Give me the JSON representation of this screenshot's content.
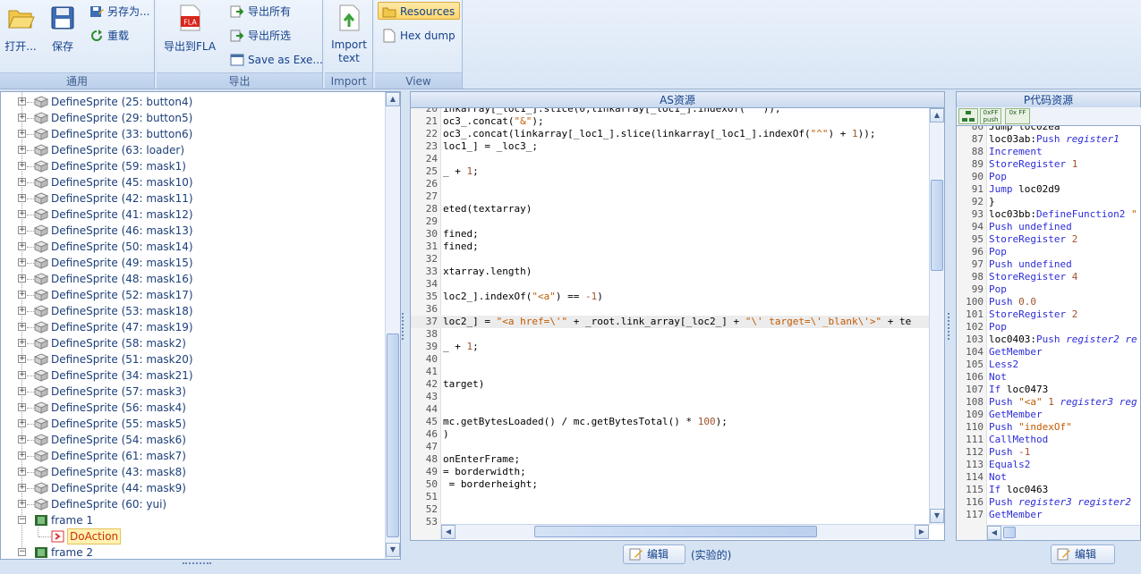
{
  "ribbon": {
    "group1_title": "通用",
    "open_label": "打开...",
    "save_label": "保存",
    "saveas_label": "另存为...",
    "reload_label": "重载",
    "group2_title": "导出",
    "export_fla_label": "导出到FLA",
    "export_all_label": "导出所有",
    "export_selected_label": "导出所选",
    "save_as_exe_label": "Save as Exe...",
    "group3_title": "Import",
    "import_text_label1": "Import",
    "import_text_label2": "text",
    "group4_title": "View",
    "resources_label": "Resources",
    "hexdump_label": "Hex dump"
  },
  "tree": {
    "items": [
      "DefineSprite (25: button4)",
      "DefineSprite (29: button5)",
      "DefineSprite (33: button6)",
      "DefineSprite (63: loader)",
      "DefineSprite (59: mask1)",
      "DefineSprite (45: mask10)",
      "DefineSprite (42: mask11)",
      "DefineSprite (41: mask12)",
      "DefineSprite (46: mask13)",
      "DefineSprite (50: mask14)",
      "DefineSprite (49: mask15)",
      "DefineSprite (48: mask16)",
      "DefineSprite (52: mask17)",
      "DefineSprite (53: mask18)",
      "DefineSprite (47: mask19)",
      "DefineSprite (58: mask2)",
      "DefineSprite (51: mask20)",
      "DefineSprite (34: mask21)",
      "DefineSprite (57: mask3)",
      "DefineSprite (56: mask4)",
      "DefineSprite (55: mask5)",
      "DefineSprite (54: mask6)",
      "DefineSprite (61: mask7)",
      "DefineSprite (43: mask8)",
      "DefineSprite (44: mask9)",
      "DefineSprite (60: yui)"
    ],
    "frame1": "frame 1",
    "doaction": "DoAction",
    "frame2": "frame 2"
  },
  "as_panel": {
    "title": "AS资源",
    "edit_label": "编辑",
    "experimental_label": "(实验的)",
    "lines": [
      {
        "n": "20",
        "h": "<span>inkarray[_loc1_].slice(0,linkarray[_loc1_].indexOf(\"^\"));</span>"
      },
      {
        "n": "21",
        "h": "oc3_.concat(<span class='str'>\"&amp;\"</span>);"
      },
      {
        "n": "22",
        "h": "oc3_.concat(linkarray[_loc1_].slice(linkarray[_loc1_].indexOf(<span class='str'>\"^\"</span>) + <span class='num'>1</span>));"
      },
      {
        "n": "23",
        "h": "loc1_] = _loc3_;"
      },
      {
        "n": "24",
        "h": ""
      },
      {
        "n": "25",
        "h": "_ + <span class='num'>1</span>;"
      },
      {
        "n": "26",
        "h": ""
      },
      {
        "n": "27",
        "h": ""
      },
      {
        "n": "28",
        "h": "eted(textarray)"
      },
      {
        "n": "29",
        "h": ""
      },
      {
        "n": "30",
        "h": "fined;"
      },
      {
        "n": "31",
        "h": "fined;"
      },
      {
        "n": "32",
        "h": ""
      },
      {
        "n": "33",
        "h": "xtarray.length)"
      },
      {
        "n": "34",
        "h": ""
      },
      {
        "n": "35",
        "h": "loc2_].indexOf(<span class='str'>\"&lt;a\"</span>) == <span class='num'>-1</span>)"
      },
      {
        "n": "36",
        "h": ""
      },
      {
        "n": "37",
        "h": "loc2_] = <span class='str'>\"&lt;a href=\\'\"</span> + _root.link_array[_loc2_] + <span class='str'>\"\\' target=\\'_blank\\'&gt;\"</span> + te"
      },
      {
        "n": "38",
        "h": ""
      },
      {
        "n": "39",
        "h": "_ + <span class='num'>1</span>;"
      },
      {
        "n": "40",
        "h": ""
      },
      {
        "n": "41",
        "h": ""
      },
      {
        "n": "42",
        "h": "target)"
      },
      {
        "n": "43",
        "h": ""
      },
      {
        "n": "44",
        "h": ""
      },
      {
        "n": "45",
        "h": "mc.getBytesLoaded() / mc.getBytesTotal() * <span class='num'>100</span>);"
      },
      {
        "n": "46",
        "h": ")"
      },
      {
        "n": "47",
        "h": ""
      },
      {
        "n": "48",
        "h": "onEnterFrame;"
      },
      {
        "n": "49",
        "h": "= borderwidth;"
      },
      {
        "n": "50",
        "h": " = borderheight;"
      },
      {
        "n": "51",
        "h": ""
      },
      {
        "n": "52",
        "h": ""
      },
      {
        "n": "53",
        "h": ""
      }
    ]
  },
  "p_panel": {
    "title": "P代码资源",
    "edit_label": "编辑",
    "tool1": "0xFF push",
    "tool2": "0x FF",
    "lines": [
      {
        "n": "86",
        "h": "Jump loc02ea"
      },
      {
        "n": "87",
        "h": "loc03ab:<span class='kw'>Push</span> <span class='it'>register1</span>"
      },
      {
        "n": "88",
        "h": "<span class='kw'>Increment</span>"
      },
      {
        "n": "89",
        "h": "<span class='kw'>StoreRegister</span> <span class='num'>1</span>"
      },
      {
        "n": "90",
        "h": "<span class='kw'>Pop</span>"
      },
      {
        "n": "91",
        "h": "<span class='kw'>Jump</span> loc02d9"
      },
      {
        "n": "92",
        "h": "}"
      },
      {
        "n": "93",
        "h": "loc03bb:<span class='kw'>DefineFunction2</span> <span class='str'>\"</span>"
      },
      {
        "n": "94",
        "h": "<span class='kw'>Push</span> <span class='kw'>undefined</span>"
      },
      {
        "n": "95",
        "h": "<span class='kw'>StoreRegister</span> <span class='num'>2</span>"
      },
      {
        "n": "96",
        "h": "<span class='kw'>Pop</span>"
      },
      {
        "n": "97",
        "h": "<span class='kw'>Push</span> <span class='kw'>undefined</span>"
      },
      {
        "n": "98",
        "h": "<span class='kw'>StoreRegister</span> <span class='num'>4</span>"
      },
      {
        "n": "99",
        "h": "<span class='kw'>Pop</span>"
      },
      {
        "n": "100",
        "h": "<span class='kw'>Push</span> <span class='num'>0.0</span>"
      },
      {
        "n": "101",
        "h": "<span class='kw'>StoreRegister</span> <span class='num'>2</span>"
      },
      {
        "n": "102",
        "h": "<span class='kw'>Pop</span>"
      },
      {
        "n": "103",
        "h": "loc0403:<span class='kw'>Push</span> <span class='it'>register2 re</span>"
      },
      {
        "n": "104",
        "h": "<span class='kw'>GetMember</span>"
      },
      {
        "n": "105",
        "h": "<span class='kw'>Less2</span>"
      },
      {
        "n": "106",
        "h": "<span class='kw'>Not</span>"
      },
      {
        "n": "107",
        "h": "<span class='kw'>If</span> loc0473"
      },
      {
        "n": "108",
        "h": "<span class='kw'>Push</span> <span class='str'>\"&lt;a\"</span> <span class='num'>1</span> <span class='it'>register3 reg</span>"
      },
      {
        "n": "109",
        "h": "<span class='kw'>GetMember</span>"
      },
      {
        "n": "110",
        "h": "<span class='kw'>Push</span> <span class='str'>\"indexOf\"</span>"
      },
      {
        "n": "111",
        "h": "<span class='kw'>CallMethod</span>"
      },
      {
        "n": "112",
        "h": "<span class='kw'>Push</span> <span class='num'>-1</span>"
      },
      {
        "n": "113",
        "h": "<span class='kw'>Equals2</span>"
      },
      {
        "n": "114",
        "h": "<span class='kw'>Not</span>"
      },
      {
        "n": "115",
        "h": "<span class='kw'>If</span> loc0463"
      },
      {
        "n": "116",
        "h": "<span class='kw'>Push</span> <span class='it'>register3 register2</span>"
      },
      {
        "n": "117",
        "h": "<span class='kw'>GetMember</span>"
      }
    ]
  }
}
